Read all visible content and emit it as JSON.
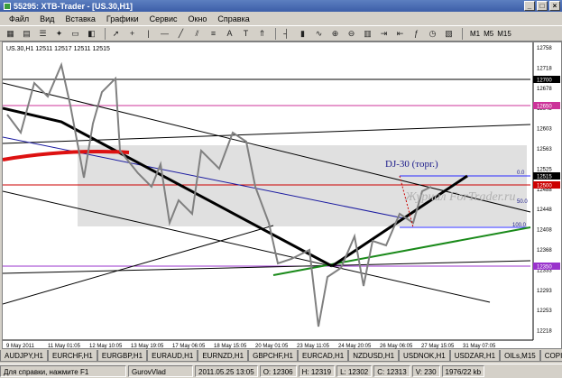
{
  "window": {
    "title": "55295: XTB-Trader - [US.30,H1]",
    "min": "_",
    "max": "□",
    "close": "×"
  },
  "menu": [
    "Файл",
    "Вид",
    "Вставка",
    "Графики",
    "Сервис",
    "Окно",
    "Справка"
  ],
  "timeframes": [
    "M1",
    "M5",
    "M15"
  ],
  "chart": {
    "header": "US.30,H1  12511 12517 12511 12515",
    "annotation": "DJ-30 (торг.)",
    "watermark": "Журнал ForTrader.ru",
    "fib_labels": [
      "0.0",
      "50.0",
      "100.0"
    ],
    "y_ticks": [
      "12758",
      "12718",
      "12678",
      "12643",
      "12603",
      "12563",
      "12525",
      "12488",
      "12448",
      "12408",
      "12368",
      "12333",
      "12293",
      "12253",
      "12218"
    ],
    "x_ticks": [
      "9 May 2011",
      "11 May 01:05",
      "12 May 10:05",
      "13 May 19:05",
      "17 May 06:05",
      "18 May 15:05",
      "20 May 01:05",
      "23 May 11:05",
      "24 May 20:05",
      "26 May 06:05",
      "27 May 15:05",
      "31 May 07:05"
    ],
    "price_badges": [
      {
        "text": "12700",
        "color": "#000000"
      },
      {
        "text": "12650",
        "color": "#cc3399"
      },
      {
        "text": "12515",
        "color": "#000000"
      },
      {
        "text": "12500",
        "color": "#cc0000"
      },
      {
        "text": "12350",
        "color": "#9933cc"
      }
    ]
  },
  "tabs": [
    "AUDJPY,H1",
    "EURCHF,H1",
    "EURGBP,H1",
    "EURAUD,H1",
    "EURNZD,H1",
    "GBPCHF,H1",
    "EURCAD,H1",
    "NZDUSD,H1",
    "USDNOK,H1",
    "USDZAR,H1",
    "OILs,M15",
    "COPI"
  ],
  "status": [
    "Для справки, нажмите F1",
    "GurovVlad",
    "2011.05.25 13:05",
    "O: 12306",
    "H: 12319",
    "L: 12302",
    "C: 12313",
    "V: 230",
    "1976/22 kb"
  ]
}
